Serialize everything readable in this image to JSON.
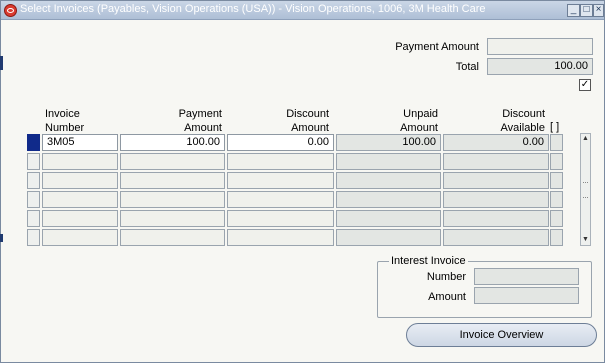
{
  "window": {
    "title": "Select Invoices (Payables, Vision Operations (USA)) - Vision Operations, 1006, 3M Health Care",
    "buttons": {
      "minimize": "_",
      "maximize": "□",
      "close": "×"
    }
  },
  "header": {
    "payment_amount_label": "Payment Amount",
    "payment_amount_value": "",
    "total_label": "Total",
    "total_value": "100.00",
    "checkbox_checked": true,
    "checkbox_mark": "✓"
  },
  "table": {
    "columns": {
      "invoice_number": "Invoice\nNumber",
      "payment_amount": "Payment\nAmount",
      "discount_amount": "Discount\nAmount",
      "unpaid_amount": "Unpaid\nAmount",
      "discount_available": "Discount\nAvailable",
      "flex": "[ ]"
    },
    "rows": [
      {
        "invoice_number": "3M05",
        "payment_amount": "100.00",
        "discount_amount": "0.00",
        "unpaid_amount": "100.00",
        "discount_available": "0.00"
      },
      {
        "invoice_number": "",
        "payment_amount": "",
        "discount_amount": "",
        "unpaid_amount": "",
        "discount_available": ""
      },
      {
        "invoice_number": "",
        "payment_amount": "",
        "discount_amount": "",
        "unpaid_amount": "",
        "discount_available": ""
      },
      {
        "invoice_number": "",
        "payment_amount": "",
        "discount_amount": "",
        "unpaid_amount": "",
        "discount_available": ""
      },
      {
        "invoice_number": "",
        "payment_amount": "",
        "discount_amount": "",
        "unpaid_amount": "",
        "discount_available": ""
      },
      {
        "invoice_number": "",
        "payment_amount": "",
        "discount_amount": "",
        "unpaid_amount": "",
        "discount_available": ""
      }
    ]
  },
  "interest_invoice": {
    "title": "Interest Invoice",
    "number_label": "Number",
    "number_value": "",
    "amount_label": "Amount",
    "amount_value": ""
  },
  "actions": {
    "invoice_overview": "Invoice Overview"
  }
}
